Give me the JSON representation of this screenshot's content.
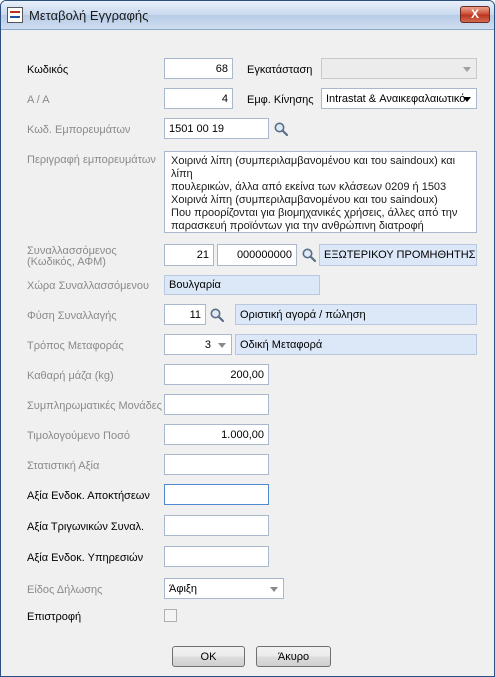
{
  "window": {
    "title": "Μεταβολή Εγγραφής",
    "close_label": "X"
  },
  "form": {
    "code": {
      "label": "Κωδικός",
      "value": "68"
    },
    "install": {
      "label": "Εγκατάσταση",
      "value": ""
    },
    "aa": {
      "label": "Α / Α",
      "value": "4"
    },
    "movement": {
      "label": "Εμφ. Κίνησης",
      "value": "Intrastat & Αναικεφαλαιωτικό"
    },
    "goods_code": {
      "label": "Κωδ. Εμπορευμάτων",
      "value": "1501 00 19"
    },
    "goods_desc": {
      "label": "Περιγραφή εμπορευμάτων",
      "lines": [
        "Χοιρινά λίπη (συμπεριλαμβανομένου και του saindoux) και λίπη",
        "πουλερικών, άλλα από εκείνα των κλάσεων 0209 ή 1503",
        "Χοιρινά λίπη (συμπεριλαμβανομένου και του saindoux)",
        "Που προορίζονται για βιομηχανικές χρήσεις, άλλες από την",
        "παρασκευή προϊόντων για την ανθρώπινη διατροφή"
      ]
    },
    "partner": {
      "label1": "Συναλλασσόμενος",
      "label2": "(Κωδικός, ΑΦΜ)",
      "code": "21",
      "afm": "000000000",
      "name": "ΕΞΩΤΕΡΙΚΟΥ ΠΡΟΜΗΘΗΤΗΣ"
    },
    "partner_country": {
      "label": "Χώρα Συναλλασσόμενου",
      "value": "Βουλγαρία"
    },
    "transaction_nature": {
      "label": "Φύση Συναλλαγής",
      "code": "11",
      "name": "Οριστική αγορά / πώληση"
    },
    "transport_mode": {
      "label": "Τρόπος Μεταφοράς",
      "code": "3",
      "name": "Οδική Μεταφορά"
    },
    "net_mass": {
      "label": "Καθαρή μάζα (kg)",
      "value": "200,00"
    },
    "supplementary_units": {
      "label": "Συμπληρωματικές Μονάδες",
      "value": ""
    },
    "invoiced_amount": {
      "label": "Τιμολογούμενο Ποσό",
      "value": "1.000,00"
    },
    "statistical_value": {
      "label": "Στατιστική Αξία",
      "value": ""
    },
    "intra_acquisitions_value": {
      "label": "Αξία Ενδοκ. Αποκτήσεων",
      "value": ""
    },
    "triangular_value": {
      "label": "Αξία Τριγωνικών Συναλ.",
      "value": ""
    },
    "intra_services_value": {
      "label": "Αξία Ενδοκ. Υπηρεσιών",
      "value": ""
    },
    "declaration_type": {
      "label": "Είδος Δήλωσης",
      "value": "Άφιξη"
    },
    "return": {
      "label": "Επιστροφή",
      "checked": false
    }
  },
  "buttons": {
    "ok": "OK",
    "cancel": "Άκυρο"
  }
}
